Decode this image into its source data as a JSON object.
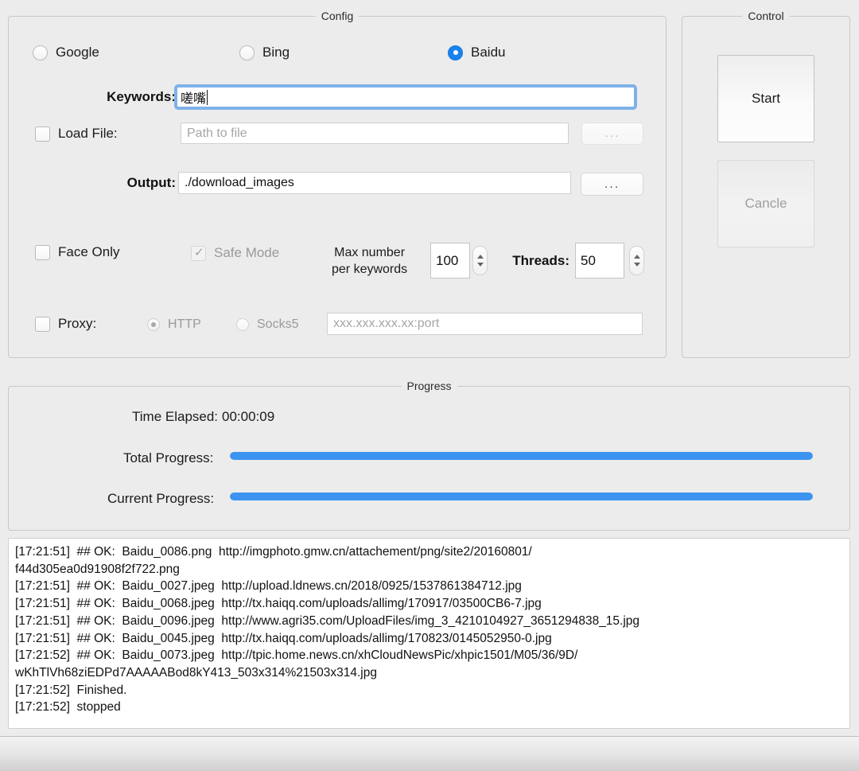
{
  "window": {
    "background": "#ececec"
  },
  "config": {
    "title": "Config",
    "engines": [
      {
        "label": "Google",
        "selected": false
      },
      {
        "label": "Bing",
        "selected": false
      },
      {
        "label": "Baidu",
        "selected": true
      }
    ],
    "keywords": {
      "label": "Keywords:",
      "value": "嗟嘴",
      "focused": true
    },
    "load_file": {
      "label": "Load File:",
      "checked": false,
      "placeholder": "Path to file",
      "value": "",
      "browse_label": "...",
      "browse_enabled": false
    },
    "output": {
      "label": "Output:",
      "value": "./download_images",
      "browse_label": "...",
      "browse_enabled": true
    },
    "face_only": {
      "label": "Face Only",
      "checked": false,
      "enabled": true
    },
    "safe_mode": {
      "label": "Safe Mode",
      "checked": true,
      "enabled": false
    },
    "max_number": {
      "label_line1": "Max number",
      "label_line2": "per keywords",
      "value": "100"
    },
    "threads": {
      "label": "Threads:",
      "value": "50"
    },
    "proxy": {
      "label": "Proxy:",
      "checked": false,
      "types": [
        {
          "label": "HTTP",
          "selected": true,
          "enabled": false
        },
        {
          "label": "Socks5",
          "selected": false,
          "enabled": false
        }
      ],
      "placeholder": "xxx.xxx.xxx.xx:port",
      "value": ""
    }
  },
  "control": {
    "title": "Control",
    "start_label": "Start",
    "start_enabled": true,
    "cancel_label": "Cancle",
    "cancel_enabled": false
  },
  "progress": {
    "title": "Progress",
    "time_elapsed_label": "Time Elapsed:",
    "time_elapsed_value": "00:00:09",
    "total_label": "Total Progress:",
    "total_percent": 100,
    "current_label": "Current Progress:",
    "current_percent": 100,
    "bar_color": "#3d94f0"
  },
  "log": {
    "text": "[17:21:51]  ## OK:  Baidu_0086.png  http://imgphoto.gmw.cn/attachement/png/site2/20160801/\nf44d305ea0d91908f2f722.png\n[17:21:51]  ## OK:  Baidu_0027.jpeg  http://upload.ldnews.cn/2018/0925/1537861384712.jpg\n[17:21:51]  ## OK:  Baidu_0068.jpeg  http://tx.haiqq.com/uploads/allimg/170917/03500CB6-7.jpg\n[17:21:51]  ## OK:  Baidu_0096.jpeg  http://www.agri35.com/UploadFiles/img_3_4210104927_3651294838_15.jpg\n[17:21:51]  ## OK:  Baidu_0045.jpeg  http://tx.haiqq.com/uploads/allimg/170823/0145052950-0.jpg\n[17:21:52]  ## OK:  Baidu_0073.jpeg  http://tpic.home.news.cn/xhCloudNewsPic/xhpic1501/M05/36/9D/\nwKhTlVh68ziEDPd7AAAAABod8kY413_503x314%21503x314.jpg\n[17:21:52]  Finished.\n[17:21:52]  stopped"
  }
}
